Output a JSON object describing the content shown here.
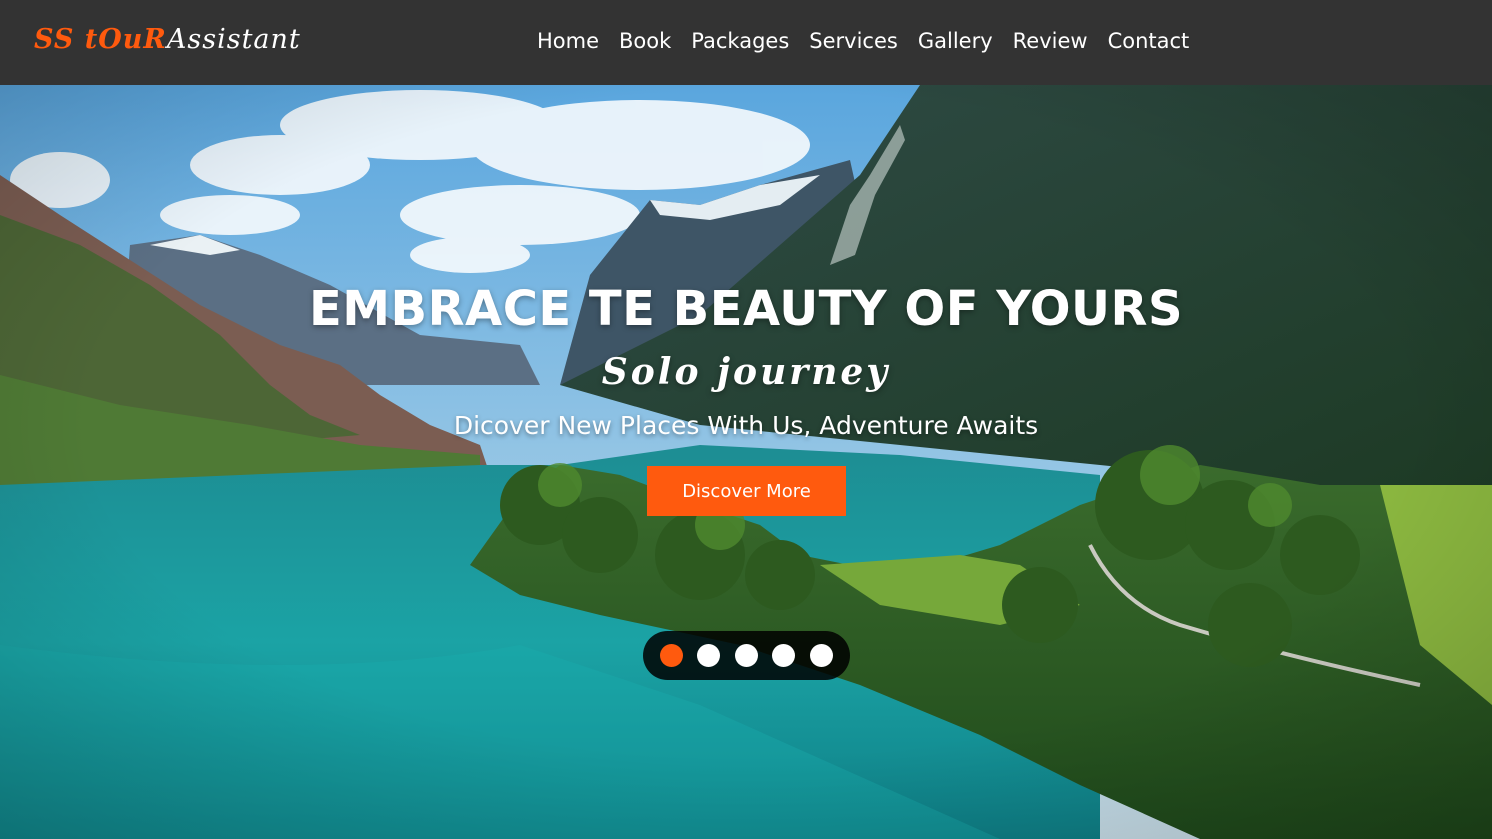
{
  "header": {
    "logo": {
      "accent": "SS tOuR",
      "rest": "Assistant"
    },
    "nav": [
      "Home",
      "Book",
      "Packages",
      "Services",
      "Gallery",
      "Review",
      "Contact"
    ]
  },
  "hero": {
    "title": "EMBRACE TE BEAUTY OF YOURS",
    "script": "Solo journey",
    "subtitle": "Dicover New Places With Us, Adventure Awaits",
    "cta_label": "Discover More",
    "slider": {
      "count": 5,
      "active_index": 0
    }
  },
  "colors": {
    "accent": "#ff5a0e",
    "header_bg": "#333333",
    "text": "#ffffff"
  }
}
